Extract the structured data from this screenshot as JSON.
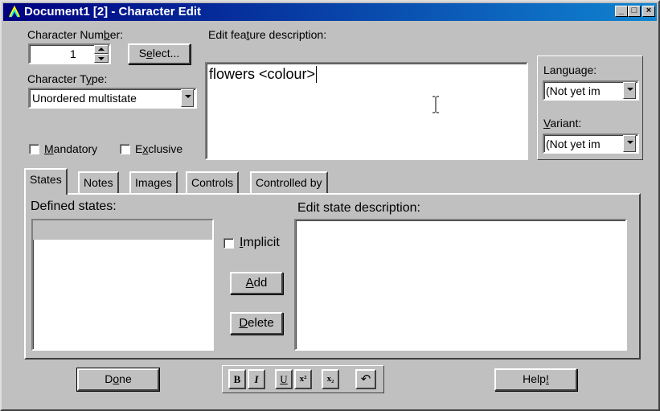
{
  "window": {
    "title": "Document1 [2] - Character Edit",
    "controls": {
      "minimize": "_",
      "maximize": "□",
      "close": "×"
    }
  },
  "character_number": {
    "label_pre": "Character Num",
    "label_u": "b",
    "label_post": "er:",
    "value": "1"
  },
  "select_button": {
    "pre": "S",
    "u": "e",
    "post": "lect..."
  },
  "character_type": {
    "label_pre": "Character T",
    "label_u": "y",
    "label_post": "pe:",
    "value": "Unordered multistate"
  },
  "mandatory": {
    "u": "M",
    "post": "andatory",
    "checked": false
  },
  "exclusive": {
    "pre": "E",
    "u": "x",
    "post": "clusive",
    "checked": false
  },
  "feature": {
    "label_pre": "Edit fea",
    "label_u": "t",
    "label_post": "ure description:",
    "value": "flowers <colour>"
  },
  "language": {
    "label": "Language:",
    "value": "(Not yet im"
  },
  "variant": {
    "label_u": "V",
    "label_post": "ariant:",
    "value": "(Not yet im"
  },
  "tabs": [
    {
      "label": "States",
      "active": true
    },
    {
      "label": "Notes",
      "active": false
    },
    {
      "label": "Images",
      "active": false
    },
    {
      "label": "Controls",
      "active": false
    },
    {
      "label": "Controlled by",
      "active": false
    }
  ],
  "states": {
    "defined_label": "Defined states:",
    "implicit": {
      "u": "I",
      "post": "mplicit",
      "checked": false
    },
    "add_button": {
      "u": "A",
      "post": "dd"
    },
    "delete_button": {
      "u": "D",
      "post": "elete"
    },
    "edit_label": "Edit state description:"
  },
  "done_button": {
    "pre": "D",
    "u": "o",
    "post": "ne"
  },
  "help_button": {
    "pre": "Help",
    "u": "!",
    "post": ""
  },
  "format_toolbar": {
    "bold": "B",
    "italic": "I",
    "underline": "U",
    "superscript": "x²",
    "subscript": "x₂",
    "undo": "↶"
  }
}
